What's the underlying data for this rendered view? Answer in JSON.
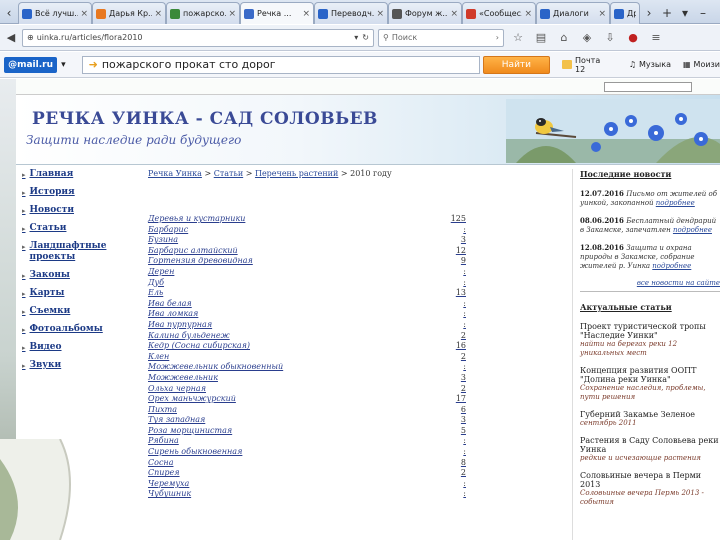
{
  "browser": {
    "tabs": [
      {
        "label": "Всё лучш...",
        "color": "#2a64c8"
      },
      {
        "label": "Дарья Кр...",
        "color": "#e87820"
      },
      {
        "label": "пожарско...",
        "color": "#3a8a3a"
      },
      {
        "label": "Речка ...",
        "color": "#3a6ac8",
        "active": true
      },
      {
        "label": "Переводч...",
        "color": "#2a64c8"
      },
      {
        "label": "Форум ж...",
        "color": "#555555"
      },
      {
        "label": "«Сообщес...",
        "color": "#d03a2a"
      },
      {
        "label": "Диалоги",
        "color": "#2a64c8"
      },
      {
        "label": "Др",
        "color": "#2a64c8"
      }
    ],
    "url": "uinka.ru/articles/flora2010",
    "search_placeholder": "Поиск"
  },
  "mailru": {
    "logo": "@mail.ru",
    "query": "пожарского прокат сто дорог",
    "find_label": "Найти",
    "mail_label": "Почта 12",
    "music_label": "Музыка",
    "extra_label": "Моизи"
  },
  "site": {
    "title": "РЕЧКА УИНКА - САД СОЛОВЬЕВ",
    "subtitle": "Защити наследие ради будущего"
  },
  "menu": [
    "Главная",
    "История",
    "Новости",
    "Статьи",
    "Ландшафтные проекты",
    "Законы",
    "Карты",
    "Съемки",
    "Фотоальбомы",
    "Видео",
    "Звуки"
  ],
  "breadcrumbs": [
    "Речка Уинка",
    "Статьи",
    "Перечень растений",
    "2010 году"
  ],
  "plants": [
    {
      "name": "Деревья и кустарники",
      "count": "125"
    },
    {
      "name": "Барбарис",
      "count": ":"
    },
    {
      "name": "Бузина",
      "count": "3"
    },
    {
      "name": "Барбарис алтайский",
      "count": "12"
    },
    {
      "name": "Гортензия древовидная",
      "count": "9"
    },
    {
      "name": "Дерен",
      "count": ":"
    },
    {
      "name": "Дуб",
      "count": ":"
    },
    {
      "name": "Ель",
      "count": "13"
    },
    {
      "name": "Ива белая",
      "count": ":"
    },
    {
      "name": "Ива ломкая",
      "count": ":"
    },
    {
      "name": "Ива пурпурная",
      "count": ":"
    },
    {
      "name": "Калина бульденеж",
      "count": "2"
    },
    {
      "name": "Кедр (Сосна сибирская)",
      "count": "16"
    },
    {
      "name": "Клен",
      "count": "2"
    },
    {
      "name": "Можжевельник обыкновенный",
      "count": ":"
    },
    {
      "name": "Можжевельник",
      "count": "3"
    },
    {
      "name": "Ольха черная",
      "count": "2"
    },
    {
      "name": "Орех маньчжурский",
      "count": "17"
    },
    {
      "name": "Пихта",
      "count": "6"
    },
    {
      "name": "Туя западная",
      "count": "3"
    },
    {
      "name": "Роза морщинистая",
      "count": "5"
    },
    {
      "name": "Рябина",
      "count": ":"
    },
    {
      "name": "Сирень обыкновенная",
      "count": ":"
    },
    {
      "name": "Сосна",
      "count": "8"
    },
    {
      "name": "Спирея",
      "count": "2"
    },
    {
      "name": "Черемуха",
      "count": ":"
    },
    {
      "name": "Чубушник",
      "count": ":"
    }
  ],
  "right": {
    "news_heading": "Последние новости",
    "news": [
      {
        "date": "12.07.2016",
        "body": "Письмо от жителей об уинкой, закопанной",
        "link": "подробнее"
      },
      {
        "date": "08.06.2016",
        "body": "Бесплатный дендрарий в Закамске, запечатлен",
        "link": "подробнее"
      },
      {
        "date": "12.08.2016",
        "body": "Защита и охрана природы в Закамске, собрание жителей р. Уинка",
        "link": "подробнее"
      }
    ],
    "all_news": "все новости на сайте",
    "current_heading": "Актуальные статьи",
    "current": [
      {
        "title": "Проект туристической тропы \"Наследие Уинки\"",
        "sub": "найти на берегах реки 12 уникальных мест"
      },
      {
        "title": "Концепция развития ООПТ \"Долина реки Уинка\"",
        "sub": "Сохранение наследия, проблемы, пути решения"
      },
      {
        "title": "Губерний Закамье Зеленое",
        "sub": "сентябрь 2011"
      },
      {
        "title": "Растения в Саду Соловьева реки Уинка",
        "sub": "редкие и исчезающие растения"
      },
      {
        "title": "Соловьиные вечера в Перми 2013",
        "sub": "Соловьиные вечера Пермь 2013 - события"
      }
    ]
  }
}
